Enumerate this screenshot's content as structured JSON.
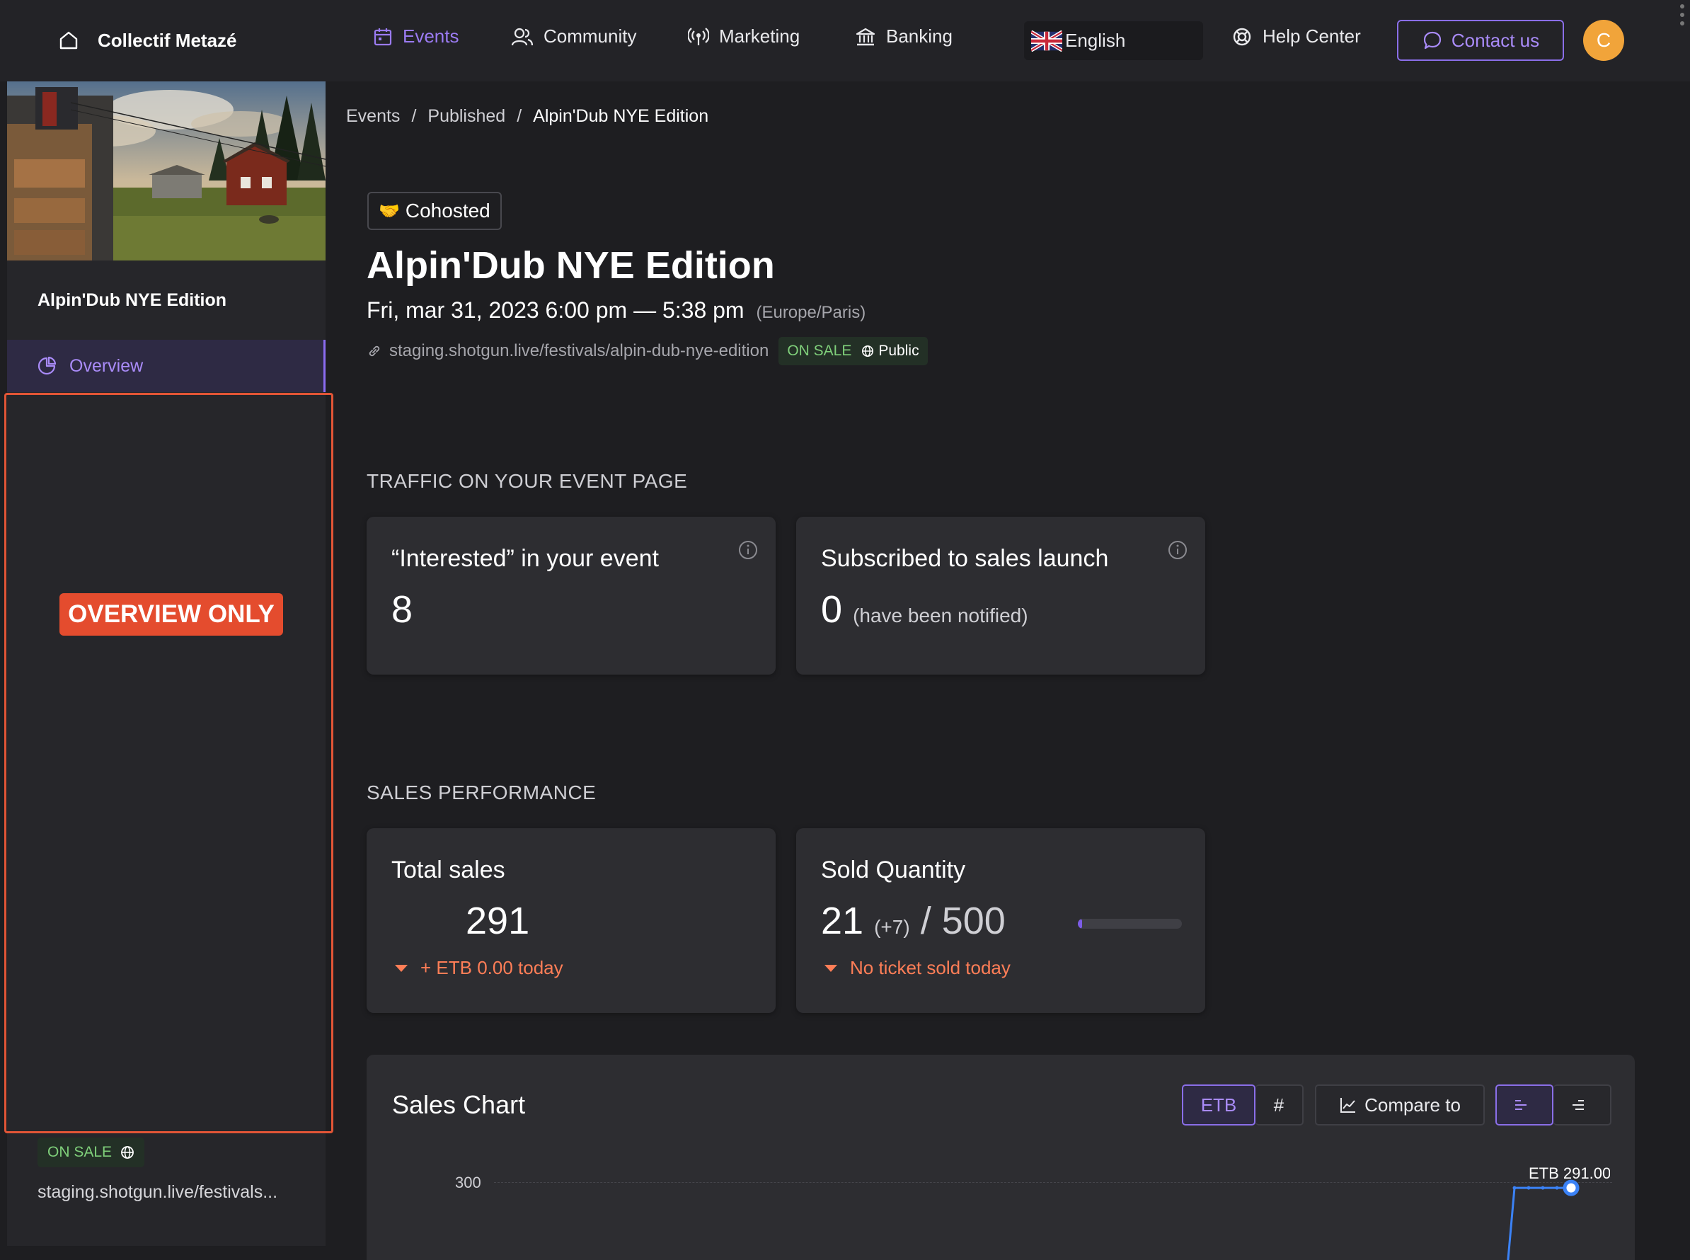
{
  "org": {
    "name": "Collectif Metazé"
  },
  "nav": {
    "events": "Events",
    "community": "Community",
    "marketing": "Marketing",
    "banking": "Banking",
    "language": "English",
    "help": "Help Center",
    "contact": "Contact us",
    "avatar_initial": "C"
  },
  "sidebar": {
    "event_title": "Alpin'Dub NYE Edition",
    "overview": "Overview",
    "overlay_label": "OVERVIEW ONLY",
    "status": "ON SALE",
    "url": "staging.shotgun.live/festivals..."
  },
  "breadcrumb": [
    "Events",
    "Published",
    "Alpin'Dub NYE Edition"
  ],
  "event": {
    "badge": "Cohosted",
    "title": "Alpin'Dub NYE Edition",
    "date": "Fri, mar 31, 2023 6:00 pm — 5:38 pm",
    "timezone": "(Europe/Paris)",
    "url": "staging.shotgun.live/festivals/alpin-dub-nye-edition",
    "status": "ON SALE",
    "visibility": "Public"
  },
  "traffic": {
    "heading": "TRAFFIC ON YOUR EVENT PAGE",
    "interested": {
      "title": "“Interested” in your event",
      "value": "8"
    },
    "subscribed": {
      "title": "Subscribed to sales launch",
      "value": "0",
      "note": "(have been notified)"
    }
  },
  "sales": {
    "heading": "SALES PERFORMANCE",
    "total": {
      "title": "Total sales",
      "value": "291",
      "trend": "+ ETB 0.00 today"
    },
    "sold": {
      "title": "Sold Quantity",
      "value": "21",
      "delta": "(+7)",
      "capacity": "/ 500",
      "fraction": 0.042,
      "trend": "No ticket sold today"
    }
  },
  "chart": {
    "title": "Sales Chart",
    "btn_currency": "ETB",
    "btn_count": "#",
    "btn_compare": "Compare to",
    "y_tick": "300",
    "point_label": "ETB 291.00"
  },
  "colors": {
    "accent": "#8b6cf0",
    "sale_green": "#7fcf7a",
    "alert": "#ff7e57",
    "overlay_red": "#e44c2e"
  },
  "chart_data": {
    "type": "line",
    "title": "Sales Chart",
    "xlabel": "",
    "ylabel": "",
    "yticks": [
      300
    ],
    "series": [
      {
        "values": [
          291,
          291,
          291,
          291,
          291
        ]
      }
    ],
    "annotations": [
      "ETB 291.00"
    ]
  }
}
